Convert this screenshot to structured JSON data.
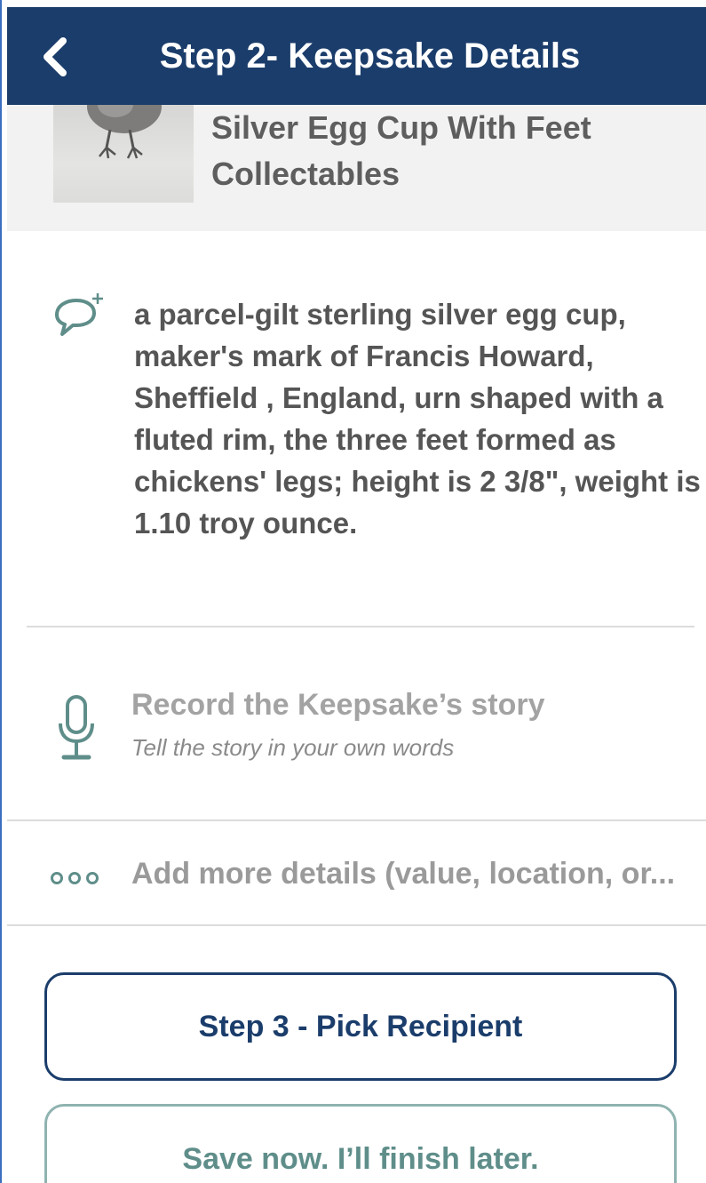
{
  "header": {
    "title": "Step 2- Keepsake Details",
    "back_icon": "chevron-left-icon"
  },
  "item": {
    "name": "Silver Egg Cup With Feet",
    "category": "Collectables"
  },
  "description": {
    "icon": "comment-add-icon",
    "text": "a parcel-gilt sterling silver egg cup, maker's mark of Francis Howard, Sheffield , England, urn shaped with a fluted rim, the three feet formed as chickens' legs; height is 2 3/8\", weight is 1.10 troy ounce."
  },
  "record": {
    "icon": "microphone-icon",
    "title": "Record the Keepsake’s story",
    "subtitle": "Tell the story in your own words"
  },
  "more_details": {
    "icon": "more-dots-icon",
    "label": "Add more details (value, location, or..."
  },
  "buttons": {
    "next_label": "Step 3 - Pick Recipient",
    "save_label": "Save now. I’ll finish later."
  },
  "colors": {
    "header_bg": "#1b3d6b",
    "accent_teal": "#5f8e8a",
    "primary_navy": "#1b3d6b"
  }
}
